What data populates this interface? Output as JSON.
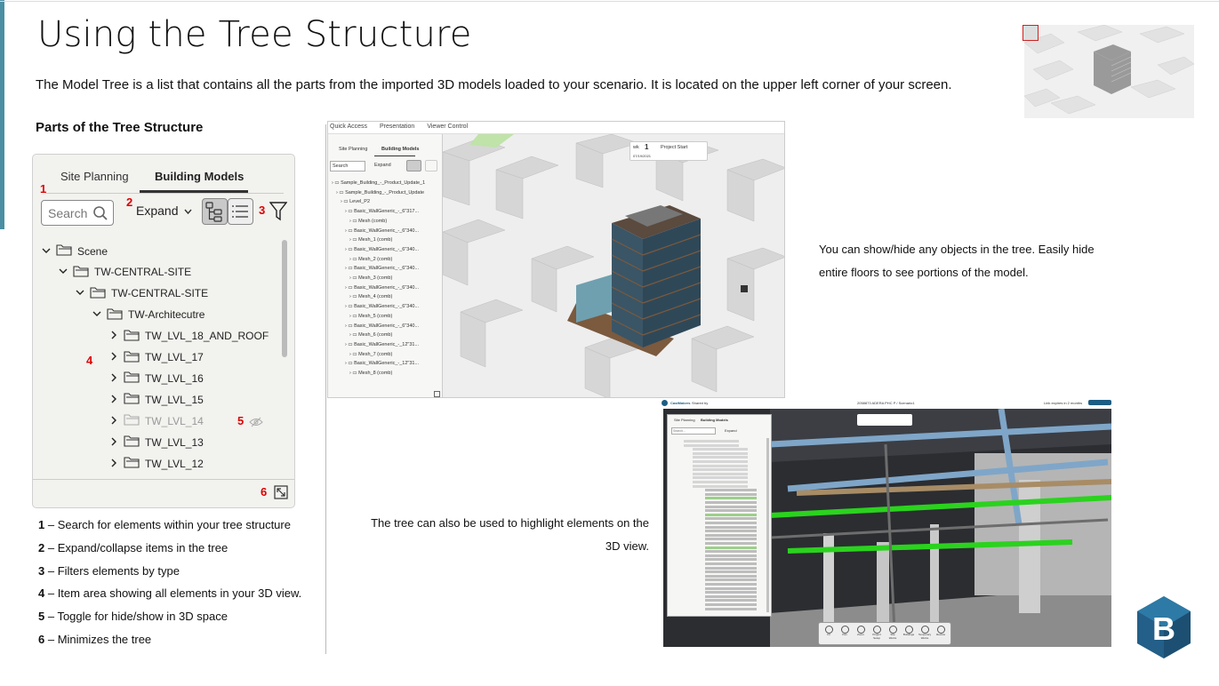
{
  "slide": {
    "title": "Using the Tree Structure",
    "subtitle": "The Model Tree is a list that contains all the parts from the imported 3D models loaded to your scenario. It is located on the upper left corner of your screen.",
    "parts_heading": "Parts of the Tree Structure"
  },
  "tree_panel": {
    "tabs": [
      "Site Planning",
      "Building Models"
    ],
    "active_tab": "Building Models",
    "search_placeholder": "Search",
    "expand_label": "Expand",
    "items": [
      {
        "label": "Scene",
        "level": 0,
        "expanded": true
      },
      {
        "label": "TW-CENTRAL-SITE",
        "level": 1,
        "expanded": true
      },
      {
        "label": "TW-CENTRAL-SITE",
        "level": 2,
        "expanded": true
      },
      {
        "label": "TW-Architecutre",
        "level": 3,
        "expanded": true
      },
      {
        "label": "TW_LVL_18_AND_ROOF",
        "level": 4,
        "expanded": false
      },
      {
        "label": "TW_LVL_17",
        "level": 4,
        "expanded": false
      },
      {
        "label": "TW_LVL_16",
        "level": 4,
        "expanded": false
      },
      {
        "label": "TW_LVL_15",
        "level": 4,
        "expanded": false
      },
      {
        "label": "TW_LVL_14",
        "level": 4,
        "expanded": false,
        "hidden": true
      },
      {
        "label": "TW_LVL_13",
        "level": 4,
        "expanded": false
      },
      {
        "label": "TW_LVL_12",
        "level": 4,
        "expanded": false
      }
    ],
    "callouts": [
      "1",
      "2",
      "3",
      "4",
      "5",
      "6"
    ]
  },
  "legend": [
    {
      "num": "1",
      "text": " – Search for elements within your tree structure"
    },
    {
      "num": "2",
      "text": " – Expand/collapse items in the tree"
    },
    {
      "num": "3",
      "text": " – Filters elements by type"
    },
    {
      "num": "4",
      "text": " – Item area showing all elements in your 3D view."
    },
    {
      "num": "5",
      "text": " – Toggle for hide/show in 3D space"
    },
    {
      "num": "6",
      "text": " – Minimizes the tree"
    }
  ],
  "screenshot1": {
    "menu": [
      "Quick Access",
      "Presentation",
      "Viewer Control"
    ],
    "tabs": [
      "Site Planning",
      "Building Models"
    ],
    "search": "Search",
    "expand": "Expand",
    "rows": [
      "Sample_Building_-_Product_Update_1",
      "Sample_Building_-_Product_Update",
      "Level_P2",
      "Basic_WallGeneric_-_6\"317...",
      "Mesh (comb)",
      "Basic_WallGeneric_-_6\"340...",
      "Mesh_1 (comb)",
      "Basic_WallGeneric_-_6\"340...",
      "Mesh_2 (comb)",
      "Basic_WallGeneric_-_6\"340...",
      "Mesh_3 (comb)",
      "Basic_WallGeneric_-_6\"340...",
      "Mesh_4 (comb)",
      "Basic_WallGeneric_-_6\"340...",
      "Mesh_5 (comb)",
      "Basic_WallGeneric_-_6\"340...",
      "Mesh_6 (comb)",
      "Basic_WallGeneric_-_12\"31...",
      "Mesh_7 (comb)",
      "Basic_WallGeneric_-_12\"31...",
      "Mesh_8 (comb)"
    ],
    "timeline_wk": "wk",
    "timeline_num": "1",
    "timeline_date": "07/19/2021",
    "timeline_label": "Project Start"
  },
  "desc_right": "You can show/hide any objects in the tree.  Easily hide entire floors to see portions of the model.",
  "desc_mid": "The tree can also be used to highlight elements on the 3D view.",
  "screenshot2": {
    "shared_by": "Shared by",
    "company": "CastMakers",
    "project": "2058873 ADERA PHC P / Scenario1",
    "expires": "Link expires in 2 months",
    "tabs": [
      "Site Planning",
      "Building Models"
    ],
    "search": "Search...",
    "expand": "Expand",
    "tools": [
      "Fit",
      "Pan",
      "Zoom",
      "Project Setup",
      "Site Works",
      "Buildings",
      "Temporary Works",
      "Review"
    ]
  }
}
